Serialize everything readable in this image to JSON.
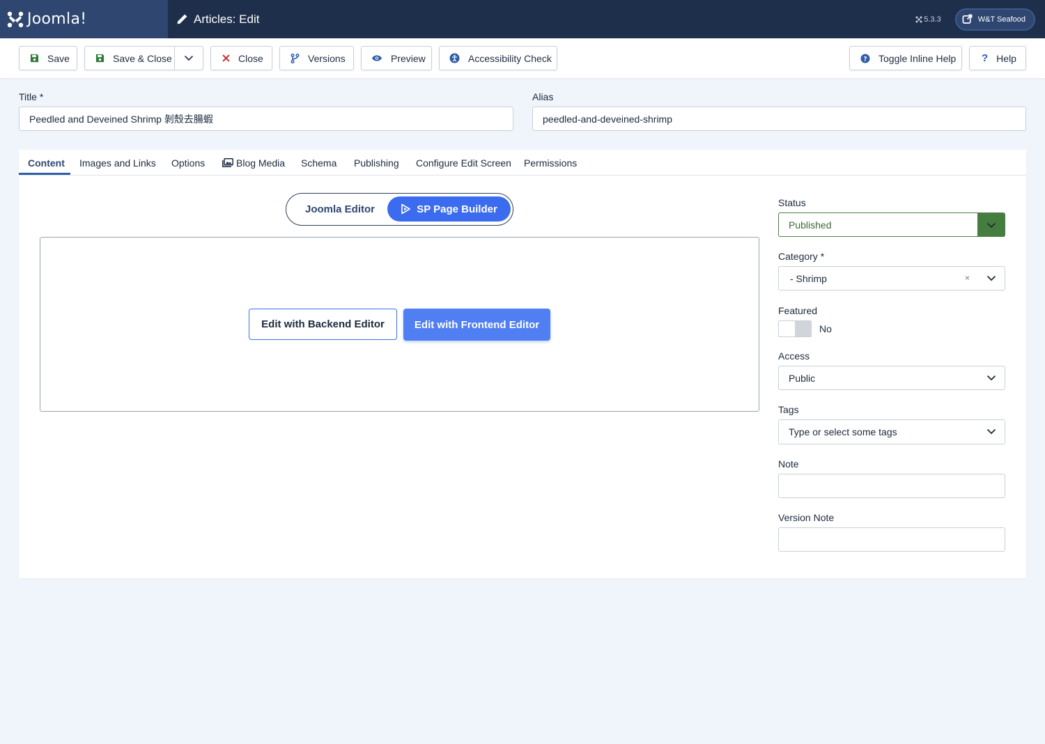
{
  "header": {
    "logo_text": "Joomla!",
    "page_title": "Articles: Edit",
    "version": "5.3.3",
    "site_button": "W&T Seafood"
  },
  "toolbar": {
    "save": "Save",
    "save_close": "Save & Close",
    "close": "Close",
    "versions": "Versions",
    "preview": "Preview",
    "accessibility": "Accessibility Check",
    "toggle_help": "Toggle Inline Help",
    "help": "Help"
  },
  "form": {
    "title_label": "Title *",
    "title_value": "Peedled and Deveined Shrimp 剝殼去腸蝦",
    "alias_label": "Alias",
    "alias_value": "peedled-and-deveined-shrimp"
  },
  "tabs": [
    {
      "label": "Content"
    },
    {
      "label": "Images and Links"
    },
    {
      "label": "Options"
    },
    {
      "label": "Blog Media"
    },
    {
      "label": "Schema"
    },
    {
      "label": "Publishing"
    },
    {
      "label": "Configure Edit Screen"
    },
    {
      "label": "Permissions"
    }
  ],
  "editor": {
    "joomla_editor": "Joomla Editor",
    "sp_page_builder": "SP Page Builder",
    "backend_button": "Edit with Backend Editor",
    "frontend_button": "Edit with Frontend Editor"
  },
  "sidebar": {
    "status_label": "Status",
    "status_value": "Published",
    "category_label": "Category *",
    "category_value": "- Shrimp",
    "clear_symbol": "×",
    "featured_label": "Featured",
    "featured_value": "No",
    "access_label": "Access",
    "access_value": "Public",
    "tags_label": "Tags",
    "tags_placeholder": "Type or select some tags",
    "note_label": "Note",
    "version_note_label": "Version Note"
  },
  "colors": {
    "header_bg": "#1e2f4b",
    "logo_bg": "#2e4670",
    "accent_blue": "#3b6cf0",
    "status_green": "#457d3e"
  }
}
